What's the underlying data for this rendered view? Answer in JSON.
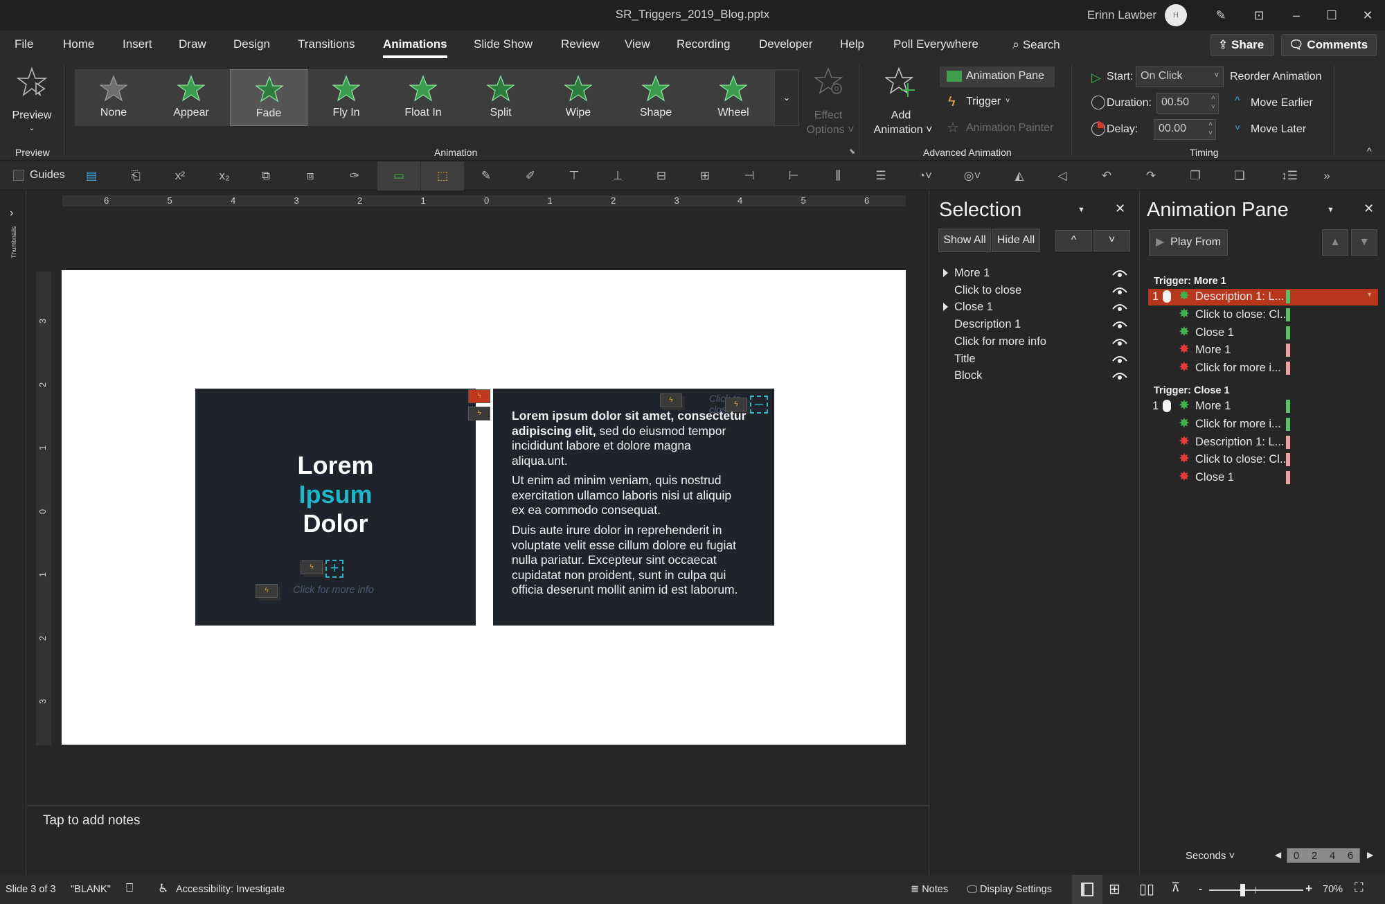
{
  "window": {
    "title": "SR_Triggers_2019_Blog.pptx",
    "user_name": "Erinn Lawber",
    "avatar_initials": "H",
    "controls": {
      "minimize": "–",
      "maximize": "☐",
      "close": "✕"
    }
  },
  "tabs": [
    {
      "label": "File"
    },
    {
      "label": "Home"
    },
    {
      "label": "Insert"
    },
    {
      "label": "Draw"
    },
    {
      "label": "Design"
    },
    {
      "label": "Transitions"
    },
    {
      "label": "Animations",
      "active": true
    },
    {
      "label": "Slide Show"
    },
    {
      "label": "Review"
    },
    {
      "label": "View"
    },
    {
      "label": "Recording"
    },
    {
      "label": "Developer"
    },
    {
      "label": "Help"
    },
    {
      "label": "Poll Everywhere"
    }
  ],
  "search": {
    "label": "Search"
  },
  "share_label": "Share",
  "comments_label": "Comments",
  "ribbon": {
    "preview": {
      "label": "Preview",
      "group_label": "Preview"
    },
    "gallery": {
      "items": [
        {
          "label": "None",
          "color": "#6e6e6e"
        },
        {
          "label": "Appear",
          "color": "#3a9c4f"
        },
        {
          "label": "Fade",
          "color": "#2e7d40",
          "selected": true
        },
        {
          "label": "Fly In",
          "color": "#3a9c4f"
        },
        {
          "label": "Float In",
          "color": "#3a9c4f"
        },
        {
          "label": "Split",
          "color": "#2e7d40"
        },
        {
          "label": "Wipe",
          "color": "#2e7d40"
        },
        {
          "label": "Shape",
          "color": "#3a9c4f"
        },
        {
          "label": "Wheel",
          "color": "#3a9c4f"
        }
      ],
      "group_label": "Animation"
    },
    "effect_options": {
      "line1": "Effect",
      "line2": "Options"
    },
    "add_animation": {
      "line1": "Add",
      "line2": "Animation"
    },
    "animation_pane_btn": "Animation Pane",
    "trigger_btn": "Trigger",
    "animation_painter_btn": "Animation Painter",
    "advanced_group_label": "Advanced Animation",
    "timing": {
      "start_label": "Start:",
      "start_value": "On Click",
      "duration_label": "Duration:",
      "duration_value": "00.50",
      "delay_label": "Delay:",
      "delay_value": "00.00",
      "reorder_label": "Reorder Animation",
      "move_earlier": "Move Earlier",
      "move_later": "Move Later",
      "group_label": "Timing"
    }
  },
  "qat": {
    "guides_label": "Guides"
  },
  "thumbnails_label": "Thumbnails",
  "ruler": {
    "h_ticks": [
      "6",
      "5",
      "4",
      "3",
      "2",
      "1",
      "0",
      "1",
      "2",
      "3",
      "4",
      "5",
      "6"
    ],
    "v_ticks": [
      "3",
      "2",
      "1",
      "0",
      "1",
      "2",
      "3"
    ]
  },
  "slide": {
    "title_line1": "Lorem",
    "title_line2": "Ipsum",
    "title_line3": "Dolor",
    "title_accent": "#1fb6c9",
    "more_info": "Click for more info",
    "close_hint": "Click to close",
    "para1_bold": "Lorem ipsum dolor sit amet, consectetur adipiscing elit,",
    "para1_rest": " sed do eiusmod tempor incididunt labore et dolore magna aliqua.unt.",
    "para2": "Ut enim ad minim veniam, quis nostrud exercitation ullamco laboris nisi ut aliquip ex ea commodo consequat.",
    "para3": "Duis aute irure dolor in reprehenderit in voluptate velit esse cillum dolore eu fugiat nulla pariatur. Excepteur sint occaecat cupidatat non proident, sunt in culpa qui officia deserunt mollit anim id est laborum."
  },
  "notes_placeholder": "Tap to add notes",
  "selection_pane": {
    "title": "Selection",
    "show_all": "Show All",
    "hide_all": "Hide All",
    "items": [
      {
        "label": "More 1",
        "expandable": true
      },
      {
        "label": "Click to close"
      },
      {
        "label": "Close 1",
        "expandable": true
      },
      {
        "label": "Description 1"
      },
      {
        "label": "Click for more info"
      },
      {
        "label": "Title"
      },
      {
        "label": "Block"
      }
    ]
  },
  "animation_pane": {
    "title": "Animation Pane",
    "play_from": "Play From",
    "triggers": [
      {
        "label": "Trigger: More 1",
        "items": [
          {
            "num": "1",
            "name": "Description 1: L...",
            "type": "entrance",
            "selected": true
          },
          {
            "name": "Click to close: Cl...",
            "type": "entrance"
          },
          {
            "name": "Close 1",
            "type": "entrance"
          },
          {
            "name": "More 1",
            "type": "exit"
          },
          {
            "name": "Click for more i...",
            "type": "exit"
          }
        ]
      },
      {
        "label": "Trigger: Close 1",
        "items": [
          {
            "num": "1",
            "name": "More 1",
            "type": "entrance"
          },
          {
            "name": "Click for more i...",
            "type": "entrance"
          },
          {
            "name": "Description 1: L...",
            "type": "exit"
          },
          {
            "name": "Click to close: Cl...",
            "type": "exit"
          },
          {
            "name": "Close 1",
            "type": "exit"
          }
        ]
      }
    ],
    "colors": {
      "entrance": "#5bbf6a",
      "exit": "#f0a0a0",
      "entrance_star": "#3fb24f",
      "exit_star": "#e53a3a"
    },
    "seconds_label": "Seconds",
    "timeline_ticks": [
      "0",
      "2",
      "4",
      "6"
    ]
  },
  "status": {
    "slide_info": "Slide 3 of 3",
    "layout": "\"BLANK\"",
    "accessibility": "Accessibility: Investigate",
    "notes": "Notes",
    "display_settings": "Display Settings",
    "zoom": "70%",
    "zoom_fraction": 0.35
  }
}
